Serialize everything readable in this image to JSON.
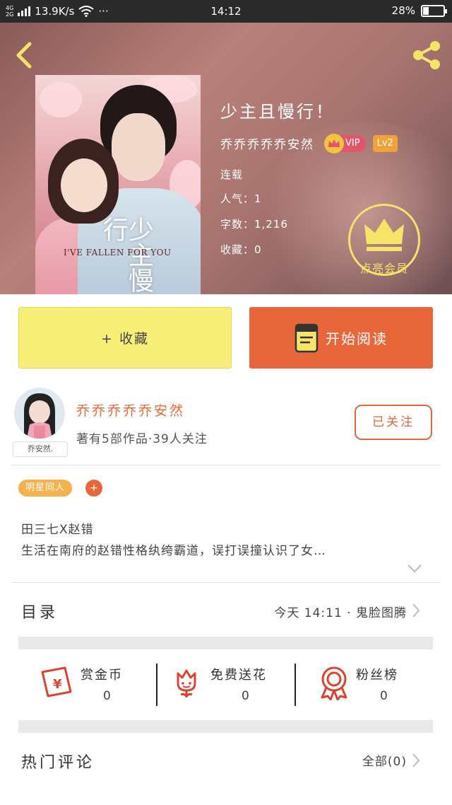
{
  "status_bar": {
    "network_types": [
      "4G",
      "2G"
    ],
    "speed": "13.9K/s",
    "more": "···",
    "time": "14:12",
    "battery_text": "28%",
    "battery_level": 0.28
  },
  "book": {
    "title": "少主且慢行！",
    "author": "乔乔乔乔乔安然",
    "vip_label": "VIP",
    "level_label": "Lv2",
    "status": "连载",
    "popularity": "人气：1",
    "word_count": "字数：1,216",
    "favorites": "收藏：0",
    "cover_title": "少主慢行",
    "cover_subtitle": "I'VE FALLEN FOR YOU"
  },
  "member": {
    "label": "点亮会员"
  },
  "actions": {
    "collect_label": "+ 收藏",
    "read_label": "开始阅读"
  },
  "author_card": {
    "name": "乔乔乔乔乔安然",
    "meta": "著有5部作品·39人关注",
    "avatar_tag": "乔安然.",
    "follow_label": "已关注"
  },
  "tags": {
    "first": "明星同人",
    "add": "+"
  },
  "description": {
    "line1": "田三七X赵错",
    "line2": "生活在南府的赵错性格纨绔霸道，误打误撞认识了女…"
  },
  "toc": {
    "title": "目录",
    "latest": "今天 14:11 · 鬼脸图腾"
  },
  "rewards": [
    {
      "label": "赏金币",
      "count": "0",
      "icon": "red-envelope-icon"
    },
    {
      "label": "免费送花",
      "count": "0",
      "icon": "flower-icon"
    },
    {
      "label": "粉丝榜",
      "count": "0",
      "icon": "rosette-icon"
    }
  ],
  "comments": {
    "title": "热门评论",
    "all_label": "全部(0)"
  },
  "colors": {
    "accent": "#e8673a",
    "collect_bg": "#f8ef79",
    "member_yellow": "#f6e36a",
    "vip_pink": "#e0566a",
    "tag_orange": "#f5b24f"
  }
}
